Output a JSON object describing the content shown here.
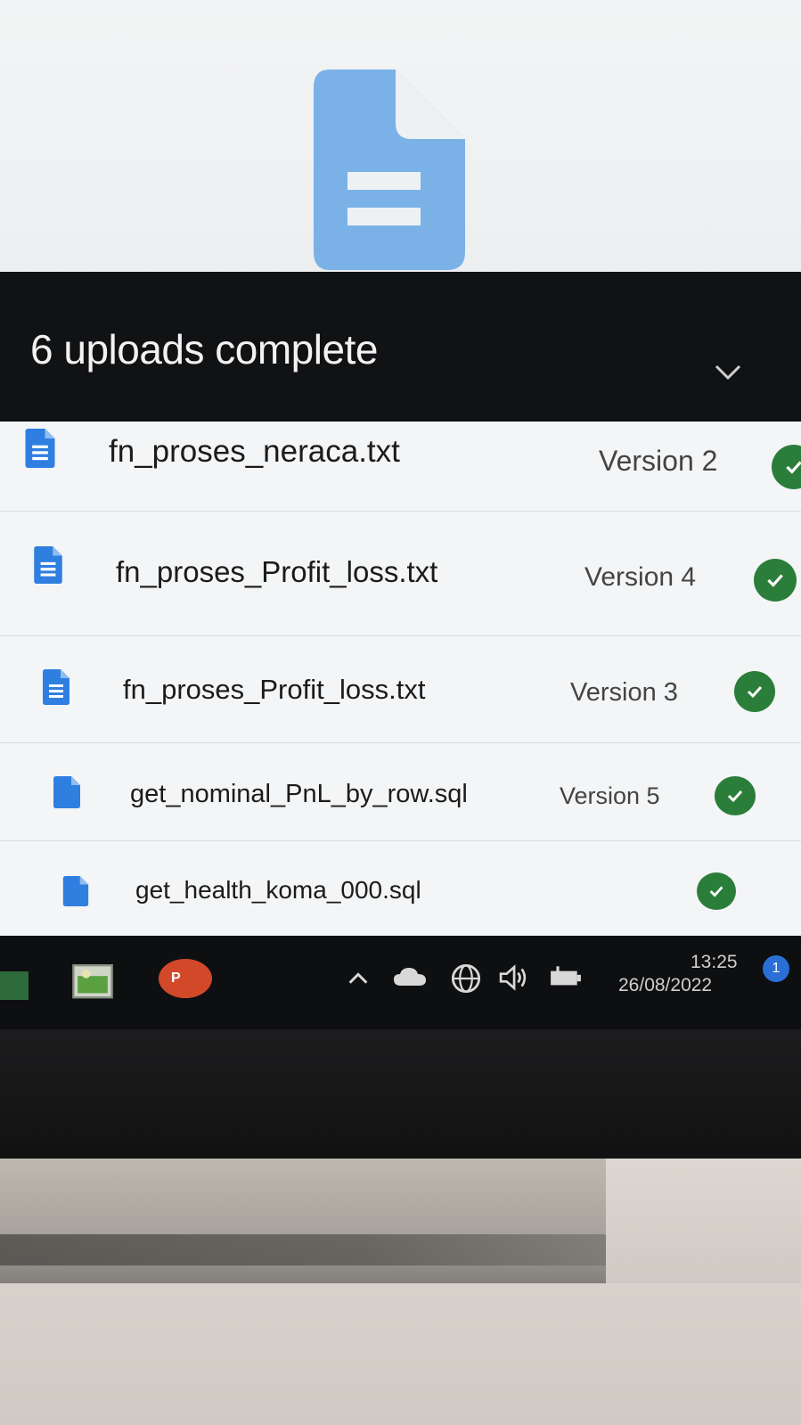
{
  "panel": {
    "title": "6 uploads complete",
    "items": [
      {
        "name": "fn_proses_neraca.txt",
        "version": "Version 2"
      },
      {
        "name": "fn_proses_Profit_loss.txt",
        "version": "Version 4"
      },
      {
        "name": "fn_proses_Profit_loss.txt",
        "version": "Version 3"
      },
      {
        "name": "get_nominal_PnL_by_row.sql",
        "version": "Version 5"
      },
      {
        "name": "get_health_koma_000.sql",
        "version": ""
      }
    ]
  },
  "taskbar": {
    "time": "13:25",
    "date": "26/08/2022",
    "notification_count": "1",
    "powerpoint_letter": "P"
  },
  "colors": {
    "doc_blue": "#2f7fe0",
    "preview_doc_blue": "#78b0e6",
    "check_green": "#2b7d3a",
    "header_bg": "#111214"
  }
}
